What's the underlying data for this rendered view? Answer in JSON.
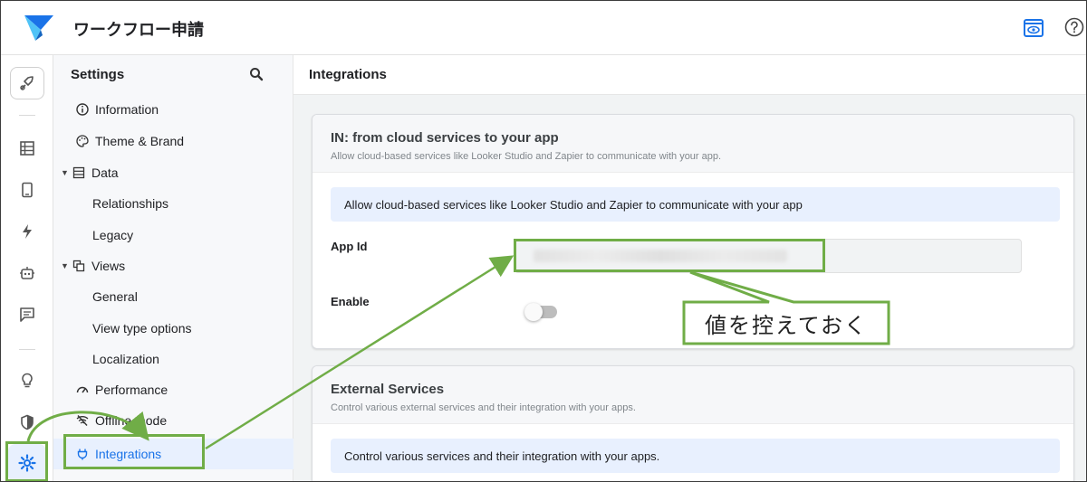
{
  "app": {
    "title": "ワークフロー申請"
  },
  "settings_nav": {
    "title": "Settings",
    "items": [
      {
        "label": "Information",
        "icon": "info-icon",
        "level": 1
      },
      {
        "label": "Theme & Brand",
        "icon": "palette-icon",
        "level": 1
      },
      {
        "label": "Data",
        "icon": "table-icon",
        "level": 0,
        "expanded": true
      },
      {
        "label": "Relationships",
        "level": 2
      },
      {
        "label": "Legacy",
        "level": 2
      },
      {
        "label": "Views",
        "icon": "views-icon",
        "level": 0,
        "expanded": true
      },
      {
        "label": "General",
        "level": 2
      },
      {
        "label": "View type options",
        "level": 2
      },
      {
        "label": "Localization",
        "level": 2
      },
      {
        "label": "Performance",
        "icon": "speedometer-icon",
        "level": 1
      },
      {
        "label": "Offline mode",
        "icon": "offline-icon",
        "level": 1
      },
      {
        "label": "Integrations",
        "icon": "plug-icon",
        "level": 1,
        "active": true
      }
    ]
  },
  "main": {
    "title": "Integrations",
    "in_card": {
      "title": "IN: from cloud services to your app",
      "subtitle": "Allow cloud-based services like Looker Studio and Zapier to communicate with your app.",
      "info": "Allow cloud-based services like Looker Studio and Zapier to communicate with your app",
      "app_id_label": "App Id",
      "enable_label": "Enable",
      "enabled": false
    },
    "external_card": {
      "title": "External Services",
      "subtitle": "Control various external services and their integration with your apps.",
      "info": "Control various services and their integration with your apps."
    }
  },
  "annotation": {
    "callout": "値を控えておく",
    "color": "#70ad47"
  },
  "colors": {
    "accent": "#1a73e8",
    "active_bg": "#e8f0fe",
    "highlight": "#70ad47"
  }
}
